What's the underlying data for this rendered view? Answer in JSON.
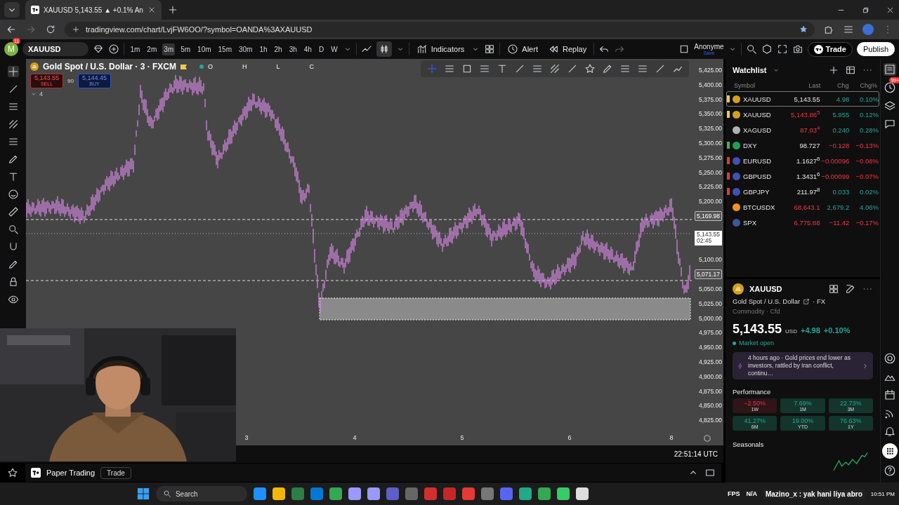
{
  "browser": {
    "tab_title": "XAUUSD 5,143.55 ▲ +0.1% An",
    "url": "tradingview.com/chart/LvjFW6OO/?symbol=OANDA%3AXAUUSD"
  },
  "toolbar": {
    "avatar": "M",
    "notifications": "11",
    "symbol": "XAUUSD",
    "intervals": [
      {
        "label": "1m",
        "selected": false
      },
      {
        "label": "2m",
        "selected": false
      },
      {
        "label": "3m",
        "selected": true
      },
      {
        "label": "5m",
        "selected": false
      },
      {
        "label": "10m",
        "selected": false
      },
      {
        "label": "15m",
        "selected": false
      },
      {
        "label": "30m",
        "selected": false
      },
      {
        "label": "1h",
        "selected": false
      },
      {
        "label": "2h",
        "selected": false
      },
      {
        "label": "3h",
        "selected": false
      },
      {
        "label": "4h",
        "selected": false
      },
      {
        "label": "D",
        "selected": false
      },
      {
        "label": "W",
        "selected": false
      }
    ],
    "indicators": "Indicators",
    "alert": "Alert",
    "replay": "Replay",
    "layout_name": "Anonyme",
    "save": "Save",
    "trade": "Trade",
    "publish": "Publish"
  },
  "legend": {
    "title": "Gold Spot / U.S. Dollar · 3 · FXCM",
    "ohlc": [
      "O",
      "H",
      "L",
      "C"
    ],
    "sell_price": "5,143.55",
    "sell": "SELL",
    "spread": "90",
    "buy_price": "5,144.45",
    "buy": "BUY",
    "indicators_count": "4"
  },
  "chart": {
    "time": "22:51:14 UTC",
    "price_scale": [
      {
        "label": "5,425.00",
        "kind": "tick"
      },
      {
        "label": "5,400.00",
        "kind": "tick"
      },
      {
        "label": "5,375.00",
        "kind": "tick"
      },
      {
        "label": "5,350.00",
        "kind": "tick"
      },
      {
        "label": "5,325.00",
        "kind": "tick"
      },
      {
        "label": "5,300.00",
        "kind": "tick"
      },
      {
        "label": "5,275.00",
        "kind": "tick"
      },
      {
        "label": "5,250.00",
        "kind": "tick"
      },
      {
        "label": "5,225.00",
        "kind": "tick"
      },
      {
        "label": "5,200.00",
        "kind": "tick"
      },
      {
        "label": "5,169.98",
        "kind": "level"
      },
      {
        "label": "5,143.55",
        "sublabel": "02:45",
        "kind": "last"
      },
      {
        "label": "5,100.00",
        "kind": "tick"
      },
      {
        "label": "5,071.17",
        "kind": "level"
      },
      {
        "label": "5,050.00",
        "kind": "tick"
      },
      {
        "label": "5,025.00",
        "kind": "tick"
      },
      {
        "label": "5,000.00",
        "kind": "tick"
      },
      {
        "label": "4,975.00",
        "kind": "tick"
      },
      {
        "label": "4,950.00",
        "kind": "tick"
      },
      {
        "label": "4,925.00",
        "kind": "tick"
      },
      {
        "label": "4,900.00",
        "kind": "tick"
      },
      {
        "label": "4,875.00",
        "kind": "tick"
      },
      {
        "label": "4,850.00",
        "kind": "tick"
      },
      {
        "label": "4,825.00",
        "kind": "tick"
      }
    ],
    "time_scale": [
      "3",
      "4",
      "5",
      "6",
      "8"
    ]
  },
  "bottom_bar": {
    "title": "Paper Trading",
    "button": "Trade"
  },
  "watchlist": {
    "title": "Watchlist",
    "columns": [
      "Symbol",
      "Last",
      "Chg",
      "Chg%"
    ],
    "rows": [
      {
        "symbol": "XAUUSD",
        "kind": "gold",
        "last": "5,143.55",
        "last_down": false,
        "chg": "4.98",
        "chg_pct": "0.10%",
        "negative": false,
        "color": "#f2c94c",
        "selected": true
      },
      {
        "symbol": "XAUUSD",
        "kind": "gold",
        "last": "5,143.86$^{5}$",
        "last_down": true,
        "chg": "5.955",
        "chg_pct": "0.12%",
        "negative": false,
        "color": "#f2c94c",
        "selected": false
      },
      {
        "symbol": "XAGUSD",
        "kind": "silver",
        "last": "87.03$^{4}$",
        "last_down": true,
        "chg": "0.240",
        "chg_pct": "0.28%",
        "negative": false,
        "selected": false
      },
      {
        "symbol": "DXY",
        "kind": "index",
        "last": "98.727",
        "last_down": false,
        "chg": "−0.128",
        "chg_pct": "−0.13%",
        "negative": true,
        "color": "#4caf50",
        "selected": false
      },
      {
        "symbol": "EURUSD",
        "kind": "currency",
        "last": "1.1627$^{6}$",
        "last_down": false,
        "chg": "−0.00096",
        "chg_pct": "−0.08%",
        "negative": true,
        "color": "#e53935",
        "selected": false
      },
      {
        "symbol": "GBPUSD",
        "kind": "currency",
        "last": "1.3431$^{6}$",
        "last_down": false,
        "chg": "−0.00099",
        "chg_pct": "−0.07%",
        "negative": true,
        "color": "#e53935",
        "selected": false
      },
      {
        "symbol": "GBPJPY",
        "kind": "currency",
        "last": "211.97$^{8}$",
        "last_down": false,
        "chg": "0.033",
        "chg_pct": "0.02%",
        "negative": false,
        "color": "#e53935",
        "selected": false
      },
      {
        "symbol": "BTCUSDX",
        "kind": "crypto",
        "last": "68,643.1",
        "last_down": true,
        "chg": "2,679.2",
        "chg_pct": "4.06%",
        "negative": false,
        "selected": false
      },
      {
        "symbol": "SPX",
        "kind": "flag",
        "last": "6,775.88",
        "last_down": true,
        "chg": "−11.42",
        "chg_pct": "−0.17%",
        "negative": true,
        "selected": false
      }
    ]
  },
  "details": {
    "symbol": "XAUUSD",
    "name": "Gold Spot / U.S. Dollar",
    "exchange": "· FX",
    "type": "Commodity · Cfd",
    "price": "5,143.55",
    "currency": "USD",
    "change": "+4.98",
    "change_pct": "+0.10%",
    "status": "Market open",
    "news": "4 hours ago · Gold prices end lower as investors, rattled by Iran conflict, continu…",
    "performance_title": "Performance",
    "performance": [
      {
        "value": "−2.50%",
        "period": "1W",
        "negative": true
      },
      {
        "value": "7.69%",
        "period": "1M",
        "negative": false
      },
      {
        "value": "22.73%",
        "period": "3M",
        "negative": false
      },
      {
        "value": "41.27%",
        "period": "6M",
        "negative": false
      },
      {
        "value": "19.00%",
        "period": "YTD",
        "negative": false
      },
      {
        "value": "76.63%",
        "period": "1Y",
        "negative": false
      }
    ],
    "seasonals_title": "Seasonals"
  },
  "side_badge": "99+",
  "taskbar": {
    "search": "Search",
    "tray": [
      "FPS",
      "N/A"
    ],
    "overlay_message": "Mazino_x : yak hani liya abro",
    "time": "10:51 PM"
  }
}
